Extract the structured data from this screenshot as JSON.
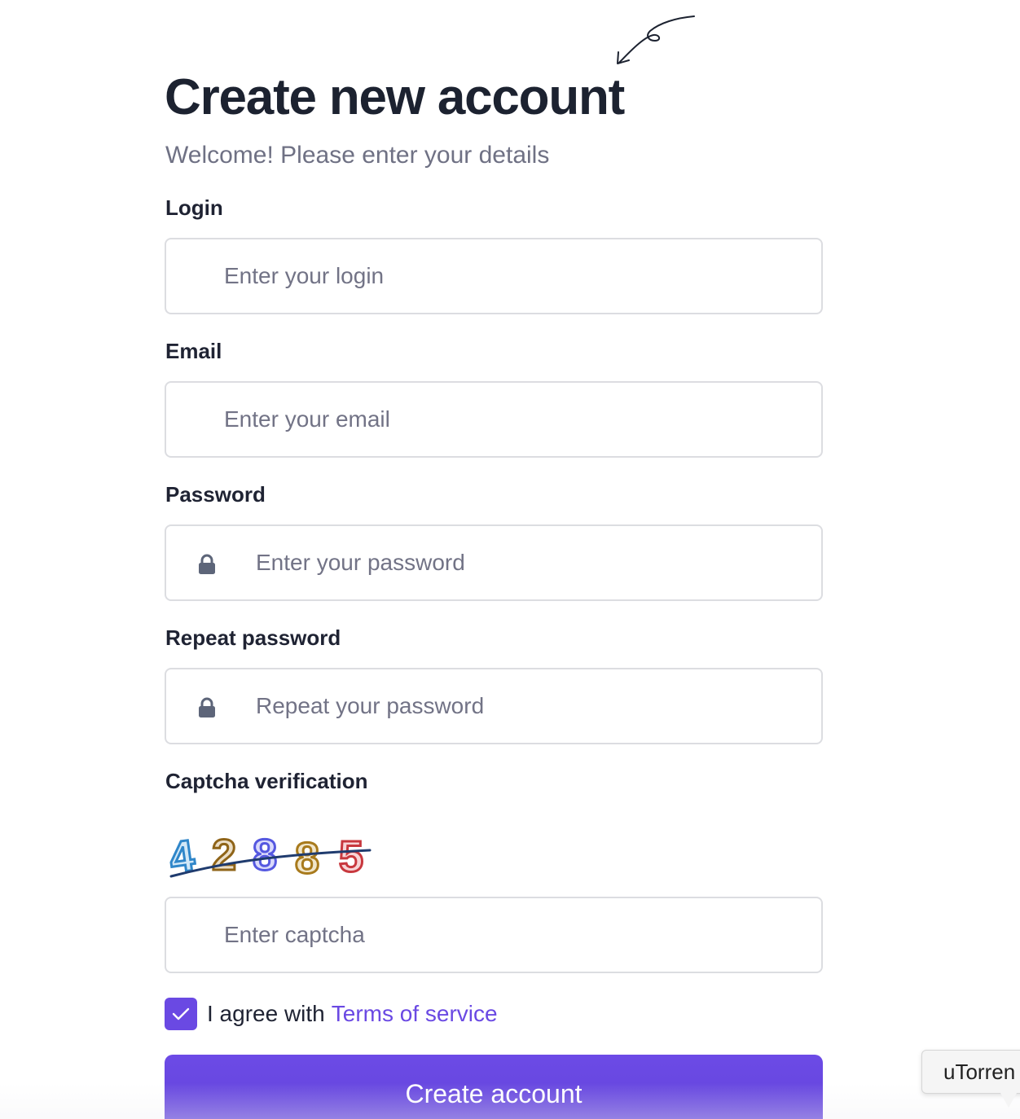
{
  "header": {
    "title": "Create new account",
    "subtitle": "Welcome! Please enter your details"
  },
  "form": {
    "login": {
      "label": "Login",
      "placeholder": "Enter your login",
      "value": ""
    },
    "email": {
      "label": "Email",
      "placeholder": "Enter your email",
      "value": ""
    },
    "password": {
      "label": "Password",
      "placeholder": "Enter your password",
      "value": "",
      "icon": "lock-icon"
    },
    "repeat_password": {
      "label": "Repeat password",
      "placeholder": "Repeat your password",
      "value": "",
      "icon": "lock-icon"
    },
    "captcha": {
      "label": "Captcha verification",
      "image_text": "42885",
      "placeholder": "Enter captcha",
      "value": ""
    },
    "agree": {
      "checked": true,
      "text": "I agree with",
      "link_text": "Terms of service"
    },
    "submit_label": "Create account"
  },
  "tooltip": {
    "text": "uTorren"
  },
  "colors": {
    "accent": "#6a49e3",
    "title": "#1c2230",
    "muted": "#6f7184",
    "border": "#dcdde1"
  }
}
